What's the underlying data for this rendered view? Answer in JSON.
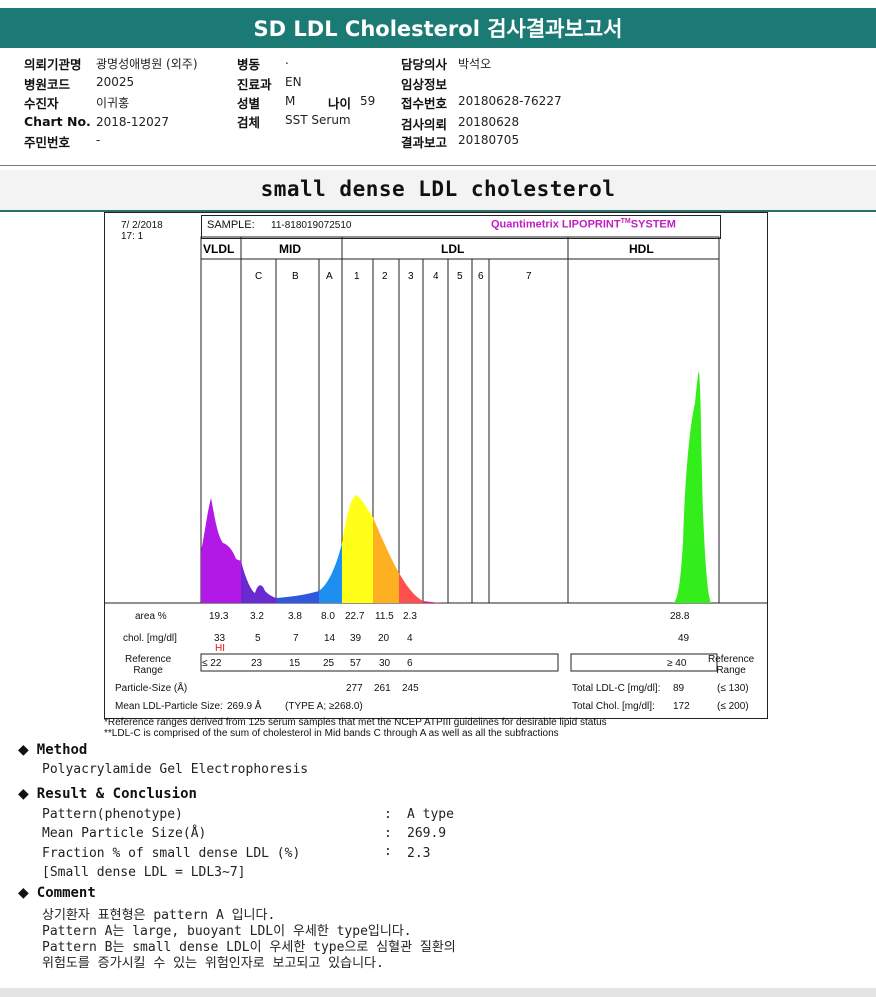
{
  "header": {
    "title": "SD LDL Cholesterol 검사결과보고서"
  },
  "patient": {
    "col1": [
      {
        "label": "의뢰기관명",
        "value": "광명성애병원 (외주)"
      },
      {
        "label": "병원코드",
        "value": "20025"
      },
      {
        "label": "수진자",
        "value": "이귀홍"
      },
      {
        "label": "Chart No.",
        "value": "2018-12027"
      },
      {
        "label": "주민번호",
        "value": "-"
      }
    ],
    "col2": [
      {
        "label": "병동",
        "value": "."
      },
      {
        "label": "진료과",
        "value": "EN"
      },
      {
        "label": "성별",
        "value": "M"
      },
      {
        "label": "검체",
        "value": "SST Serum"
      }
    ],
    "age": {
      "label": "나이",
      "value": "59"
    },
    "col3": [
      {
        "label": "담당의사",
        "value": "박석오"
      },
      {
        "label": "임상정보",
        "value": ""
      },
      {
        "label": "접수번호",
        "value": "20180628-76227"
      },
      {
        "label": "검사의뢰",
        "value": "20180628"
      },
      {
        "label": "결과보고",
        "value": "20180705"
      }
    ]
  },
  "section_title": "small dense LDL cholesterol",
  "report": {
    "date": "7/ 2/2018",
    "time": "17: 1",
    "sample_label": "SAMPLE:",
    "sample_id": "11-818019072510",
    "system_brand": "Quantimetrix LIPOPRINT",
    "system_tm": "TM",
    "system_suffix": "SYSTEM",
    "groups": {
      "vldl": "VLDL",
      "mid": "MID",
      "ldl": "LDL",
      "hdl": "HDL"
    },
    "bands": [
      "C",
      "B",
      "A",
      "1",
      "2",
      "3",
      "4",
      "5",
      "6",
      "7"
    ],
    "area_label": "area %",
    "chol_label": "chol. [mg/dl]",
    "ref_label_1": "Reference",
    "ref_label_2": "Range",
    "area_values": [
      "19.3",
      "3.2",
      "3.8",
      "8.0",
      "22.7",
      "11.5",
      "2.3"
    ],
    "area_hdl": "28.8",
    "chol_values": [
      "33",
      "5",
      "7",
      "14",
      "39",
      "20",
      "4"
    ],
    "chol_hdl": "49",
    "hi_flag": "HI",
    "ref_values": [
      "≤ 22",
      "23",
      "15",
      "25",
      "57",
      "30",
      "6"
    ],
    "ref_hdl": "≥ 40",
    "particle_label": "Particle-Size (Å)",
    "particle_values": [
      "277",
      "261",
      "245"
    ],
    "mean_label": "Mean LDL-Particle Size:",
    "mean_value": "269.9 Å",
    "mean_type": "(TYPE A; ≥268.0)",
    "total_ldl_label": "Total LDL-C [mg/dl]:",
    "total_ldl_value": "89",
    "total_ldl_ref": "(≤ 130)",
    "total_chol_label": "Total Chol. [mg/dl]:",
    "total_chol_value": "172",
    "total_chol_ref": "(≤ 200)"
  },
  "notes": [
    "*Reference ranges derived from 125 serum samples that met the NCEP ATPIII guidelines for desirable lipid status",
    "**LDL-C is comprised of the sum of cholesterol in Mid bands C through A as well as all the subfractions"
  ],
  "method": {
    "heading": "Method",
    "text": "Polyacrylamide Gel Electrophoresis"
  },
  "result": {
    "heading": "Result & Conclusion",
    "rows": [
      {
        "label": "Pattern(phenotype)",
        "value": "A type"
      },
      {
        "label": "Mean Particle Size(Å)",
        "value": "269.9"
      },
      {
        "label": "Fraction % of small dense LDL (%)",
        "value": "2.3"
      }
    ],
    "extra": "[Small dense LDL = LDL3~7]"
  },
  "comment": {
    "heading": "Comment",
    "lines": [
      "상기환자 표현형은 pattern A 입니다.",
      "Pattern A는 large, buoyant LDL이 우세한 type입니다.",
      "Pattern B는 small dense LDL이 우세한 type으로 심혈관 질환의",
      "위험도를 증가시킬 수 있는 위험인자로 보고되고 있습니다."
    ]
  }
}
